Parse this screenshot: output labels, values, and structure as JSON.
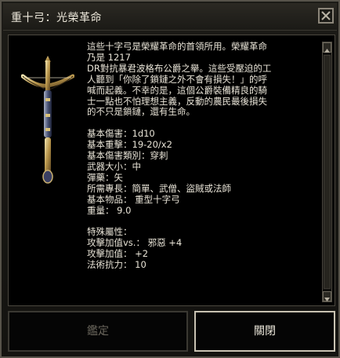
{
  "window": {
    "title": "重十弓：光榮革命",
    "close_icon": "close-x-icon"
  },
  "item": {
    "icon": "heavy-crossbow-icon",
    "description": [
      "這些十字弓是榮耀革命的首領所用。榮耀革命",
      "乃是 1217",
      "DR對抗暴君波格布公爵之舉。這些受壓迫的工",
      "人聽到「你除了鎖鏈之外不會有損失！」的呼",
      "喊而起義。不幸的是，這個公爵裝備精良的騎",
      "士一點也不怕理想主義，反動的農民最後損失",
      "的不只是鎖鏈，還有生命。"
    ],
    "stats": [
      "基本傷害：1d10",
      "基本重擊：19-20/x2",
      "基本傷害類別：穿刺",
      "武器大小：中",
      "彈藥：矢",
      "所需專長：簡單、武僧、盜賊或法師",
      "基本物品： 重型十字弓",
      "重量： 9.0"
    ],
    "properties_title": "特殊屬性：",
    "properties": [
      "攻擊加值vs.： 邪惡 +4",
      "攻擊加值： +2",
      "法術抗力： 10"
    ]
  },
  "buttons": {
    "identify_label": "鑑定",
    "close_label": "關閉"
  },
  "colors": {
    "text": "#e9e4d7",
    "disabled_text": "#6b675d",
    "panel_bg": "#000000",
    "frame": "#57534a"
  }
}
